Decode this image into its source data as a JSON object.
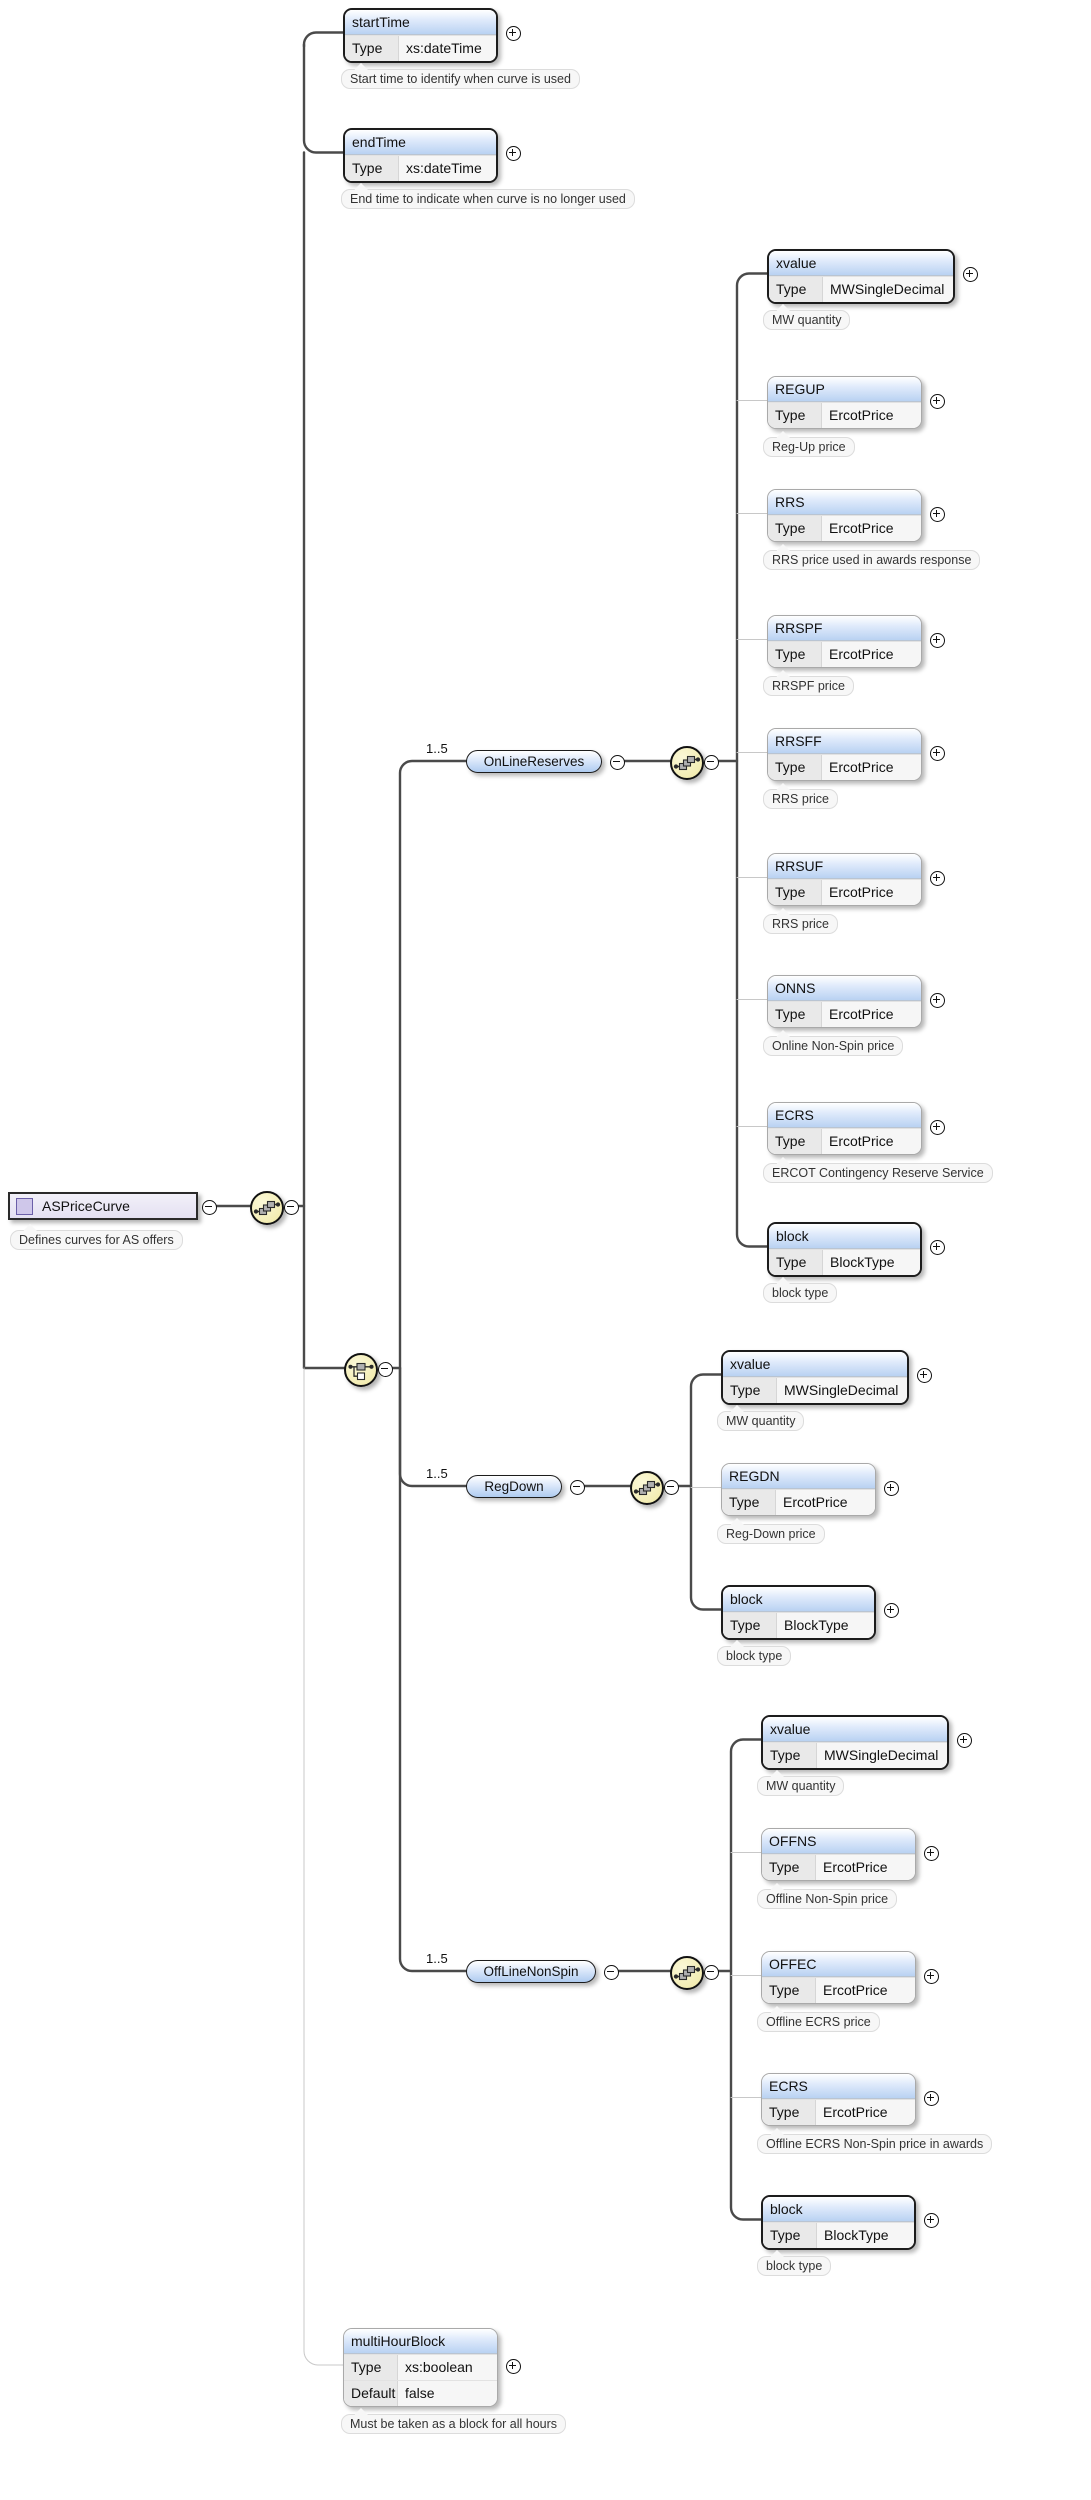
{
  "diagram": {
    "title": "ASPriceCurve",
    "type": "xml-schema-tree",
    "colors": {
      "node_header_gradient_top": "#ffffff",
      "node_header_gradient_bottom": "#b9d2f2",
      "compositor_fill": "#f3edb4",
      "root_fill": "#e4e0f2",
      "required_border": "#1c1c1c",
      "optional_border": "#a9a9a9",
      "annotation_fill": "#f7f7f7"
    }
  },
  "root": {
    "label": "ASPriceCurve",
    "annotation": "Defines curves for AS offers",
    "icon": "schema-element-icon"
  },
  "compositors": [
    {
      "id": "seq-root",
      "kind": "sequence",
      "toggle": "minus"
    },
    {
      "id": "choice-main",
      "kind": "choice",
      "toggle": "minus"
    },
    {
      "id": "seq-online",
      "kind": "sequence",
      "toggle": "minus"
    },
    {
      "id": "seq-regdown",
      "kind": "sequence",
      "toggle": "minus"
    },
    {
      "id": "seq-offline",
      "kind": "sequence",
      "toggle": "minus"
    }
  ],
  "top_elements": [
    {
      "name": "startTime",
      "rows": [
        {
          "key": "Type",
          "value": "xs:dateTime"
        }
      ],
      "annotation": "Start time to identify when curve is used",
      "required": true,
      "toggle": "plus"
    },
    {
      "name": "endTime",
      "rows": [
        {
          "key": "Type",
          "value": "xs:dateTime"
        }
      ],
      "annotation": "End time to indicate when curve is no longer used",
      "required": true,
      "toggle": "plus"
    }
  ],
  "branches": [
    {
      "id": "online",
      "label": "OnLineReserves",
      "cardinality": "1..5",
      "required": true,
      "toggle": "minus",
      "children": [
        {
          "name": "xvalue",
          "rows": [
            {
              "key": "Type",
              "value": "MWSingleDecimal"
            }
          ],
          "annotation": "MW quantity",
          "required": true,
          "toggle": "plus"
        },
        {
          "name": "REGUP",
          "rows": [
            {
              "key": "Type",
              "value": "ErcotPrice"
            }
          ],
          "annotation": "Reg-Up price",
          "required": false,
          "toggle": "plus"
        },
        {
          "name": "RRS",
          "rows": [
            {
              "key": "Type",
              "value": "ErcotPrice"
            }
          ],
          "annotation": "RRS price used in awards response",
          "required": false,
          "toggle": "plus"
        },
        {
          "name": "RRSPF",
          "rows": [
            {
              "key": "Type",
              "value": "ErcotPrice"
            }
          ],
          "annotation": "RRSPF price",
          "required": false,
          "toggle": "plus"
        },
        {
          "name": "RRSFF",
          "rows": [
            {
              "key": "Type",
              "value": "ErcotPrice"
            }
          ],
          "annotation": "RRS price",
          "required": false,
          "toggle": "plus"
        },
        {
          "name": "RRSUF",
          "rows": [
            {
              "key": "Type",
              "value": "ErcotPrice"
            }
          ],
          "annotation": "RRS price",
          "required": false,
          "toggle": "plus"
        },
        {
          "name": "ONNS",
          "rows": [
            {
              "key": "Type",
              "value": "ErcotPrice"
            }
          ],
          "annotation": "Online Non-Spin price",
          "required": false,
          "toggle": "plus"
        },
        {
          "name": "ECRS",
          "rows": [
            {
              "key": "Type",
              "value": "ErcotPrice"
            }
          ],
          "annotation": "ERCOT Contingency Reserve Service",
          "required": false,
          "toggle": "plus"
        },
        {
          "name": "block",
          "rows": [
            {
              "key": "Type",
              "value": "BlockType"
            }
          ],
          "annotation": "block type",
          "required": true,
          "toggle": "plus"
        }
      ]
    },
    {
      "id": "regdown",
      "label": "RegDown",
      "cardinality": "1..5",
      "required": true,
      "toggle": "minus",
      "children": [
        {
          "name": "xvalue",
          "rows": [
            {
              "key": "Type",
              "value": "MWSingleDecimal"
            }
          ],
          "annotation": "MW quantity",
          "required": true,
          "toggle": "plus"
        },
        {
          "name": "REGDN",
          "rows": [
            {
              "key": "Type",
              "value": "ErcotPrice"
            }
          ],
          "annotation": "Reg-Down price",
          "required": false,
          "toggle": "plus"
        },
        {
          "name": "block",
          "rows": [
            {
              "key": "Type",
              "value": "BlockType"
            }
          ],
          "annotation": "block type",
          "required": true,
          "toggle": "plus"
        }
      ]
    },
    {
      "id": "offline",
      "label": "OffLineNonSpin",
      "cardinality": "1..5",
      "required": true,
      "toggle": "minus",
      "children": [
        {
          "name": "xvalue",
          "rows": [
            {
              "key": "Type",
              "value": "MWSingleDecimal"
            }
          ],
          "annotation": "MW quantity",
          "required": true,
          "toggle": "plus"
        },
        {
          "name": "OFFNS",
          "rows": [
            {
              "key": "Type",
              "value": "ErcotPrice"
            }
          ],
          "annotation": "Offline Non-Spin price",
          "required": false,
          "toggle": "plus"
        },
        {
          "name": "OFFEC",
          "rows": [
            {
              "key": "Type",
              "value": "ErcotPrice"
            }
          ],
          "annotation": "Offline ECRS price",
          "required": false,
          "toggle": "plus"
        },
        {
          "name": "ECRS",
          "rows": [
            {
              "key": "Type",
              "value": "ErcotPrice"
            }
          ],
          "annotation": "Offline ECRS Non-Spin price in awards",
          "required": false,
          "toggle": "plus"
        },
        {
          "name": "block",
          "rows": [
            {
              "key": "Type",
              "value": "BlockType"
            }
          ],
          "annotation": "block type",
          "required": true,
          "toggle": "plus"
        }
      ]
    }
  ],
  "bottom_elements": [
    {
      "name": "multiHourBlock",
      "rows": [
        {
          "key": "Type",
          "value": "xs:boolean"
        },
        {
          "key": "Default",
          "value": "false"
        }
      ],
      "annotation": "Must be taken as a block for all hours",
      "required": false,
      "toggle": "plus"
    }
  ]
}
